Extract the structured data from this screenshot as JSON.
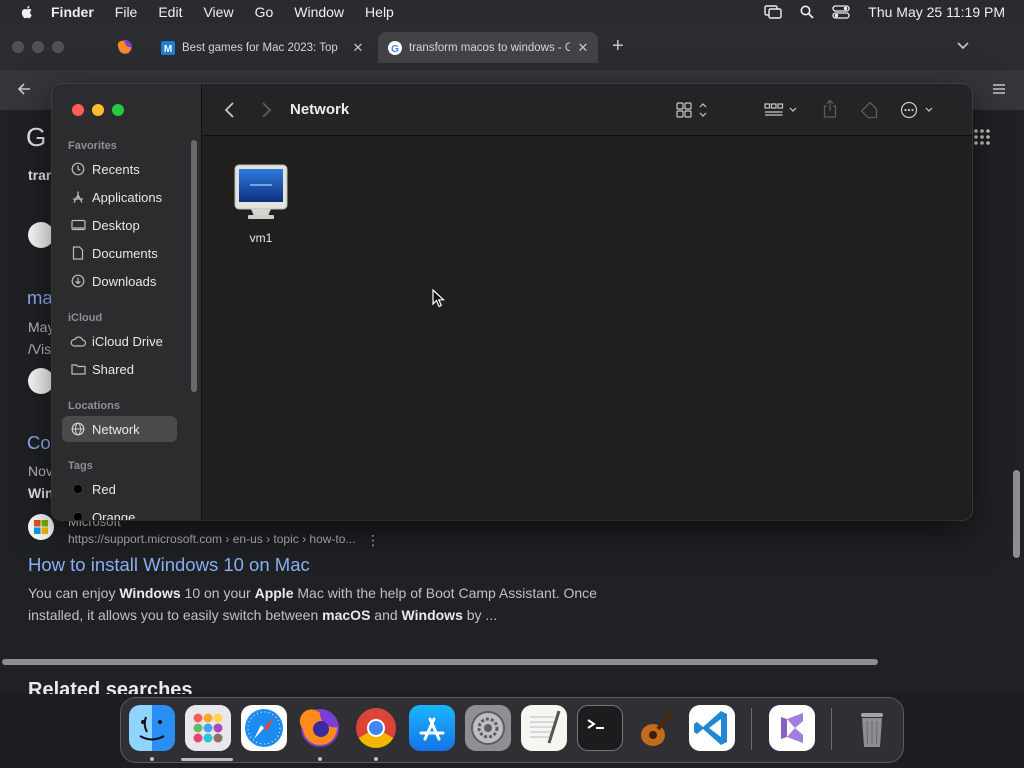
{
  "menubar": {
    "items": [
      "Finder",
      "File",
      "Edit",
      "View",
      "Go",
      "Window",
      "Help"
    ],
    "clock": "Thu May 25  11:19 PM"
  },
  "browser": {
    "tabs": [
      {
        "title": "Best games for Mac 2023: Top",
        "favicon": "macworld-icon"
      },
      {
        "title": "transform macos to windows - G",
        "favicon": "google-icon"
      }
    ],
    "partial_texts": {
      "logo_fragment": "G",
      "query_fragment": "tran",
      "link1_fragment": "ma",
      "date_fragment": "May",
      "path_fragment": "/Vis",
      "link2_fragment": "Co",
      "date2_fragment": "Nov",
      "bold_fragment": "Win",
      "related_fragment": "Related searches"
    },
    "result": {
      "site_name": "Microsoft",
      "url": "https://support.microsoft.com › en-us › topic › how-to...",
      "title": "How to install Windows 10 on Mac",
      "snippet_parts": [
        {
          "text": "You can enjoy ",
          "bold": false
        },
        {
          "text": "Windows",
          "bold": true
        },
        {
          "text": " 10 on your ",
          "bold": false
        },
        {
          "text": "Apple",
          "bold": true
        },
        {
          "text": " Mac with the help of Boot Camp Assistant. Once installed, it allows you to easily switch between ",
          "bold": false
        },
        {
          "text": "macOS",
          "bold": true
        },
        {
          "text": " and ",
          "bold": false
        },
        {
          "text": "Windows",
          "bold": true
        },
        {
          "text": " by ...",
          "bold": false
        }
      ]
    }
  },
  "finder": {
    "title": "Network",
    "sidebar": {
      "sections": [
        {
          "label": "Favorites",
          "items": [
            {
              "label": "Recents",
              "icon": "clock-icon"
            },
            {
              "label": "Applications",
              "icon": "applications-icon"
            },
            {
              "label": "Desktop",
              "icon": "desktop-icon"
            },
            {
              "label": "Documents",
              "icon": "document-icon"
            },
            {
              "label": "Downloads",
              "icon": "download-icon"
            }
          ]
        },
        {
          "label": "iCloud",
          "items": [
            {
              "label": "iCloud Drive",
              "icon": "cloud-icon"
            },
            {
              "label": "Shared",
              "icon": "shared-folder-icon"
            }
          ]
        },
        {
          "label": "Locations",
          "items": [
            {
              "label": "Network",
              "icon": "globe-icon",
              "selected": true
            }
          ]
        },
        {
          "label": "Tags",
          "items": [
            {
              "label": "Red",
              "icon": "tag-dot-icon"
            },
            {
              "label": "Orange",
              "icon": "tag-dot-icon"
            }
          ]
        }
      ]
    },
    "items": [
      {
        "label": "vm1",
        "icon": "computer-monitor-icon"
      }
    ]
  },
  "dock": {
    "apps": [
      "finder-icon",
      "launchpad-icon",
      "safari-icon",
      "firefox-icon",
      "chrome-icon",
      "app-store-icon",
      "system-settings-icon",
      "textedit-icon",
      "terminal-icon",
      "garageband-icon",
      "vscode-icon",
      "visual-studio-icon",
      "trash-icon"
    ]
  },
  "colors": {
    "link": "#8ab4f8",
    "close": "#ff5f57",
    "minimize": "#febc2e",
    "zoom": "#28c840"
  }
}
